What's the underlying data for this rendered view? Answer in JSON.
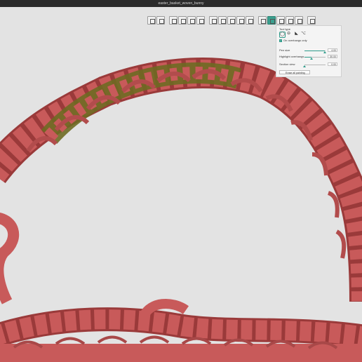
{
  "window": {
    "title": "easter_basket_woven_bunny"
  },
  "toolbar": {
    "icons": [
      "add-object-icon",
      "delete-icon",
      "arrange-icon",
      "copy-icon",
      "paste-icon",
      "clone-icon",
      "layers-icon",
      "move-icon",
      "scale-icon",
      "rotate-icon",
      "place-on-face-icon",
      "cut-icon",
      "paint-support-icon",
      "seam-icon",
      "text-icon",
      "measure-icon",
      "assembly-icon"
    ]
  },
  "panel": {
    "tool_type_label": "Tool type",
    "on_overhangs_label": "On overhangs only",
    "on_overhangs_checked": true,
    "pen_size_label": "Pen size",
    "pen_size_value": "4.00",
    "pen_size_level": 0.95,
    "highlight_label": "Highlight overhangs",
    "highlight_value": "30.00",
    "highlight_level": 0.33,
    "section_label": "Section view",
    "section_value": "0.00",
    "section_level": 0.0,
    "erase_label": "Erase all painting"
  },
  "colors": {
    "model": "#c85a5a",
    "painted": "#6e6a22",
    "accent": "#2f9b8a",
    "background": "#e3e3e3"
  }
}
